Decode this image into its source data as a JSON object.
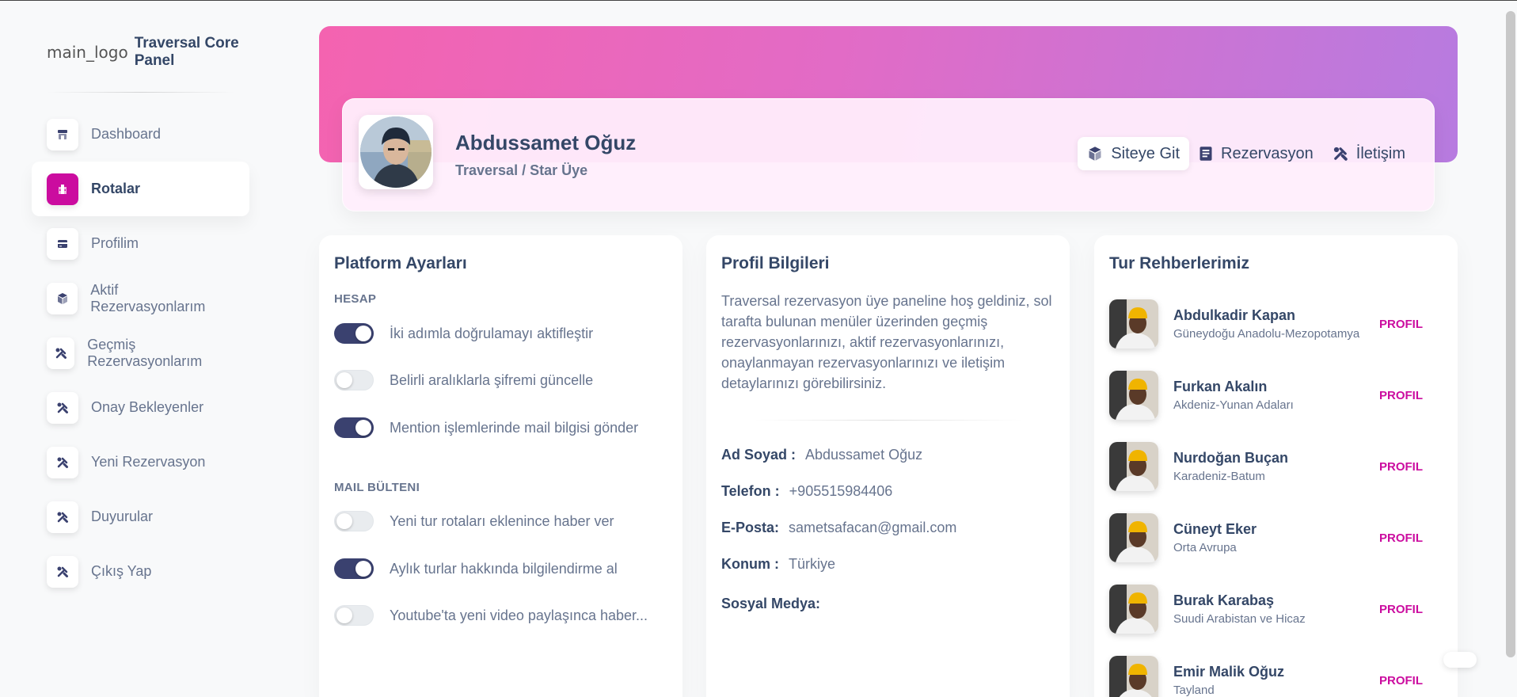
{
  "brand": {
    "logo_alt": "main_logo",
    "name": "Traversal Core Panel"
  },
  "sidebar": {
    "items": [
      {
        "label": "Dashboard",
        "icon": "shop-icon"
      },
      {
        "label": "Rotalar",
        "icon": "office-icon",
        "active": true
      },
      {
        "label": "Profilim",
        "icon": "credit-card-icon"
      },
      {
        "label": "Aktif Rezervasyonlarım",
        "icon": "box-3d-icon"
      },
      {
        "label": "Geçmiş Rezervasyonlarım",
        "icon": "settings-tools-icon"
      },
      {
        "label": "Onay Bekleyenler",
        "icon": "settings-tools-icon"
      },
      {
        "label": "Yeni Rezervasyon",
        "icon": "settings-tools-icon"
      },
      {
        "label": "Duyurular",
        "icon": "settings-tools-icon"
      },
      {
        "label": "Çıkış Yap",
        "icon": "settings-tools-icon"
      }
    ]
  },
  "profile": {
    "name": "Abdussamet Oğuz",
    "role": "Traversal / Star Üye",
    "tabs": [
      {
        "label": "Siteye Git",
        "icon": "cube-icon",
        "active": true
      },
      {
        "label": "Rezervasyon",
        "icon": "document-icon"
      },
      {
        "label": "İletişim",
        "icon": "tools-icon"
      }
    ]
  },
  "platform": {
    "title": "Platform Ayarları",
    "account_section": "HESAP",
    "account_toggles": [
      {
        "label": "İki adımla doğrulamayı aktifleştir",
        "on": true
      },
      {
        "label": "Belirli aralıklarla şifremi güncelle",
        "on": false
      },
      {
        "label": "Mention işlemlerinde mail bilgisi gönder",
        "on": true
      }
    ],
    "mail_section": "MAIL BÜLTENI",
    "mail_toggles": [
      {
        "label": "Yeni tur rotaları eklenince haber ver",
        "on": false
      },
      {
        "label": "Aylık turlar hakkında bilgilendirme al",
        "on": true
      },
      {
        "label": "Youtube'ta yeni video paylaşınca haber...",
        "on": false
      }
    ]
  },
  "info": {
    "title": "Profil Bilgileri",
    "intro": "Traversal rezervasyon üye paneline hoş geldiniz, sol tarafta bulunan menüler üzerinden geçmiş rezervasyonlarınızı, aktif rezervasyonlarınızı, onaylanmayan rezervasyonlarınızı ve iletişim detaylarınızı görebilirsiniz.",
    "fields": [
      {
        "key": "Ad Soyad :",
        "value": "Abdussamet Oğuz"
      },
      {
        "key": "Telefon :",
        "value": "+905515984406"
      },
      {
        "key": "E-Posta:",
        "value": "sametsafacan@gmail.com"
      },
      {
        "key": "Konum :",
        "value": "Türkiye"
      },
      {
        "key": "Sosyal Medya:",
        "value": ""
      }
    ]
  },
  "guides": {
    "title": "Tur Rehberlerimiz",
    "button_label": "PROFIL",
    "items": [
      {
        "name": "Abdulkadir Kapan",
        "location": "Güneydoğu Anadolu-Mezopotamya"
      },
      {
        "name": "Furkan Akalın",
        "location": "Akdeniz-Yunan Adaları"
      },
      {
        "name": "Nurdoğan Buçan",
        "location": "Karadeniz-Batum"
      },
      {
        "name": "Cüneyt Eker",
        "location": "Orta Avrupa"
      },
      {
        "name": "Burak Karabaş",
        "location": "Suudi Arabistan ve Hicaz"
      },
      {
        "name": "Emir Malik Oğuz",
        "location": "Tayland"
      }
    ]
  }
}
